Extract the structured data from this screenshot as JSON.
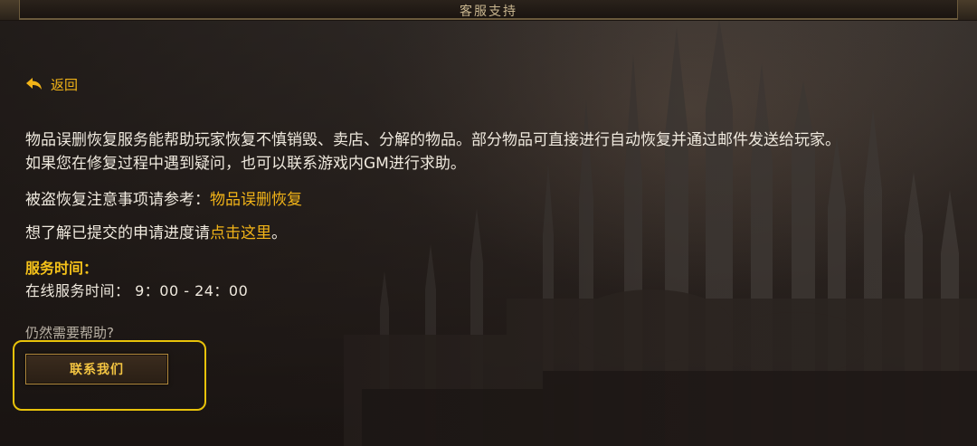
{
  "window": {
    "title": "客服支持"
  },
  "nav": {
    "back_label": "返回"
  },
  "intro": {
    "line1": "物品误删恢复服务能帮助玩家恢复不慎销毁、卖店、分解的物品。部分物品可直接进行自动恢复并通过邮件发送给玩家。",
    "line2": "如果您在修复过程中遇到疑问，也可以联系游戏内GM进行求助。"
  },
  "notice": {
    "prefix": "被盗恢复注意事项请参考：",
    "link": "物品误删恢复"
  },
  "progress": {
    "prefix": "想了解已提交的申请进度请",
    "link": "点击这里",
    "suffix": "。"
  },
  "service": {
    "title": "服务时间：",
    "hours": "在线服务时间：  9：00 - 24：00"
  },
  "help": {
    "question": "仍然需要帮助?",
    "contact_label": "联系我们"
  },
  "colors": {
    "accent": "#f2b418",
    "highlight_frame": "#e8c20a",
    "text": "#efe9de"
  },
  "icons": {
    "back": "back-arrow-icon"
  }
}
